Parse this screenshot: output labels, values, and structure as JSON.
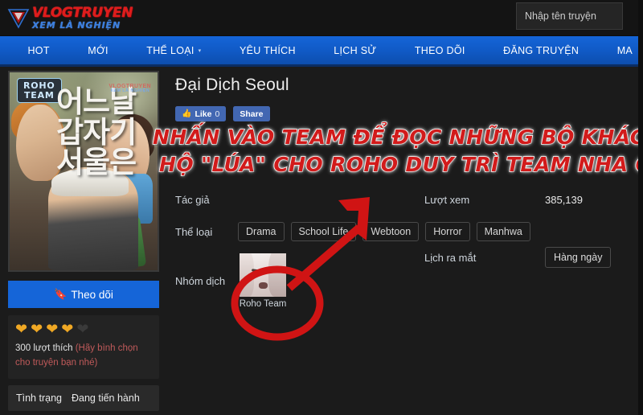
{
  "header": {
    "logo_top": "VLOGTRUYEN",
    "logo_bottom": "XEM LÀ NGHIỆN",
    "logo_icon": "triangle-v-logo-icon",
    "search_placeholder": "Nhập tên truyện",
    "search_value": ""
  },
  "nav": {
    "items": [
      {
        "label": "HOT",
        "caret": ""
      },
      {
        "label": "MỚI",
        "caret": ""
      },
      {
        "label": "THỂ LOẠI",
        "caret": "▾"
      },
      {
        "label": "YÊU THÍCH",
        "caret": ""
      },
      {
        "label": "LỊCH SỬ",
        "caret": ""
      },
      {
        "label": "THEO DÕI",
        "caret": ""
      },
      {
        "label": "ĐĂNG TRUYỆN",
        "caret": ""
      },
      {
        "label": "MA",
        "caret": ""
      }
    ]
  },
  "cover": {
    "badge_line1": "ROHO",
    "badge_line2": "TEAM",
    "korean_title": "어느날\n갑자기\n서울은",
    "watermark_top": "VLOGTRUYEN",
    "watermark_bottom": "XEM LÀ NGHIỆN"
  },
  "sidebar": {
    "follow_label": "Theo dõi",
    "follow_icon": "bookmark-icon",
    "hearts_filled": 4,
    "hearts_total": 5,
    "heart_color": "#f0a824",
    "likes_text": "300 lượt thích",
    "likes_note": "(Hãy bình chọn cho truyện bạn nhé)",
    "status_label": "Tình trạng",
    "status_value": "Đang tiến hành"
  },
  "main": {
    "title": "Đại Dịch Seoul",
    "fb_like_label": "Like",
    "fb_like_count": "0",
    "fb_share_label": "Share",
    "author_label": "Tác giả",
    "author_value": "",
    "views_label": "Lượt xem",
    "views_value": "385,139",
    "genre_label": "Thể loại",
    "genres": [
      "Drama",
      "School Life",
      "Webtoon",
      "Horror",
      "Manhwa"
    ],
    "team_label": "Nhóm dịch",
    "team_name": "Roho Team",
    "schedule_label": "Lịch ra mắt",
    "schedule_value": "Hàng ngày"
  },
  "annotation": {
    "line1": "NHẤN VÀO TEAM ĐỂ ĐỌC NHỮNG BỘ KHÁC ỦNG",
    "line2": "HỘ \"LÚA\" CHO ROHO DUY TRÌ TEAM NHA CẢ NHÀ!!",
    "color": "#d21b1b",
    "arrow_name": "red-arrow-annotation",
    "circle_name": "red-circle-annotation"
  }
}
